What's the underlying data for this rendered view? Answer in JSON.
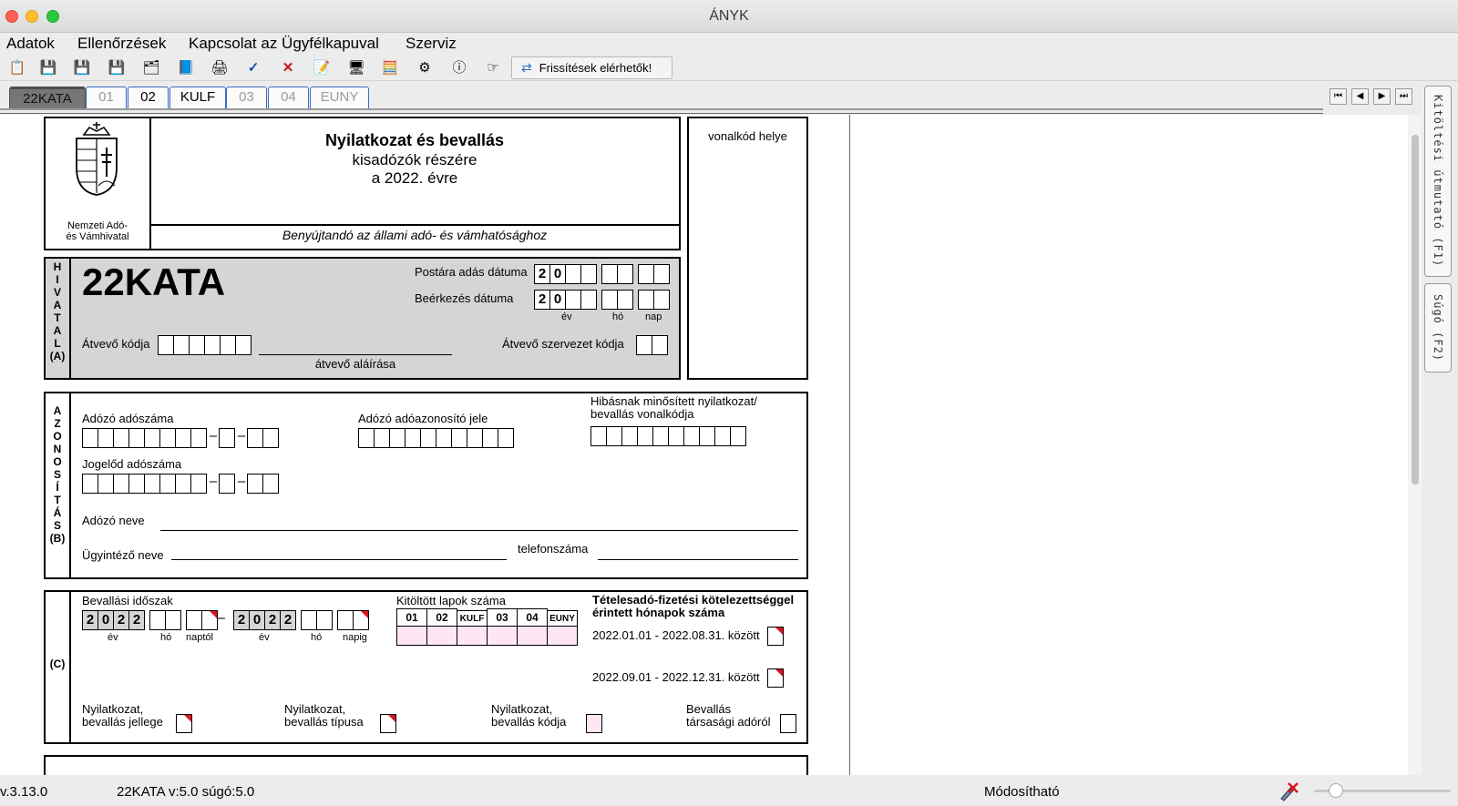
{
  "window": {
    "title": "ÁNYK"
  },
  "menu": [
    "Adatok",
    "Ellenőrzések",
    "Kapcsolat az Ügyfélkapuval",
    "Szerviz"
  ],
  "toolbar": {
    "icons": [
      "new-icon",
      "save-icon",
      "save-close-icon",
      "save-as-icon",
      "import-icon",
      "form-icon",
      "print-icon",
      "check-icon",
      "delete-icon",
      "note-icon",
      "monitor-icon",
      "calculator-icon",
      "settings-icon",
      "info-icon",
      "pointer-icon"
    ],
    "update_label": "Frissítések elérhetők!"
  },
  "tabs": [
    {
      "label": "22KATA",
      "state": "active"
    },
    {
      "label": "01",
      "state": "dim"
    },
    {
      "label": "02",
      "state": "normal"
    },
    {
      "label": "KULF",
      "state": "normal"
    },
    {
      "label": "03",
      "state": "dim"
    },
    {
      "label": "04",
      "state": "dim"
    },
    {
      "label": "EUNY",
      "state": "dim"
    }
  ],
  "side_tabs": [
    "Kitöltési útmutató (F1)",
    "Súgó (F2)"
  ],
  "form": {
    "header": {
      "title": "Nyilatkozat és bevallás",
      "subtitle1": "kisadózók részére",
      "subtitle2": "a 2022. évre",
      "submit_to": "Benyújtandó az állami adó- és vámhatósághoz",
      "logo_caption1": "Nemzeti Adó-",
      "logo_caption2": "és Vámhivatal",
      "barcode_place": "vonalkód helye"
    },
    "section_a": {
      "side_label": [
        "H",
        "I",
        "V",
        "A",
        "T",
        "A",
        "L",
        "(A)"
      ],
      "form_code": "22KATA",
      "post_date_label": "Postára adás dátuma",
      "arrival_date_label": "Beérkezés dátuma",
      "year_prefix": [
        "2",
        "0"
      ],
      "date_units": [
        "év",
        "hó",
        "nap"
      ],
      "receiver_code_label": "Átvevő kódja",
      "receiver_signature_label": "átvevő aláírása",
      "receiver_org_code_label": "Átvevő szervezet kódja"
    },
    "section_b": {
      "side_label": [
        "A",
        "Z",
        "O",
        "N",
        "O",
        "S",
        "Í",
        "T",
        "Á",
        "S",
        "(B)"
      ],
      "taxpayer_tax_number_label": "Adózó adószáma",
      "taxpayer_id_label": "Adózó adóazonosító jele",
      "faulty_barcode_label1": "Hibásnak minősített nyilatkozat/",
      "faulty_barcode_label2": "bevallás vonalkódja",
      "predecessor_tax_number_label": "Jogelőd adószáma",
      "taxpayer_name_label": "Adózó neve",
      "administrator_name_label": "Ügyintéző neve",
      "phone_label": "telefonszáma",
      "dash": "–"
    },
    "section_c": {
      "side_label": "(C)",
      "period_label": "Bevallási időszak",
      "period_from_year": [
        "2",
        "0",
        "2",
        "2"
      ],
      "period_to_year": [
        "2",
        "0",
        "2",
        "2"
      ],
      "period_units_from": [
        "év",
        "hó",
        "naptól"
      ],
      "period_units_to": [
        "év",
        "hó",
        "napig"
      ],
      "pages_filled_label": "Kitöltött lapok száma",
      "pages_columns": [
        "01",
        "02",
        "KULF",
        "03",
        "04",
        "EUNY"
      ],
      "flat_tax_title1": "Tételesadó-fizetési kötelezettséggel",
      "flat_tax_title2": "érintett hónapok száma",
      "range1": "2022.01.01 - 2022.08.31. között",
      "range2": "2022.09.01 - 2022.12.31. között",
      "decl_nature_label1": "Nyilatkozat,",
      "decl_nature_label2": "bevallás jellege",
      "decl_type_label1": "Nyilatkozat,",
      "decl_type_label2": "bevallás típusa",
      "decl_code_label1": "Nyilatkozat,",
      "decl_code_label2": "bevallás kódja",
      "corp_tax_label1": "Bevallás",
      "corp_tax_label2": "társasági adóról"
    }
  },
  "status": {
    "version": "v.3.13.0",
    "form_version": "22KATA v:5.0 súgó:5.0",
    "mode": "Módosítható"
  }
}
